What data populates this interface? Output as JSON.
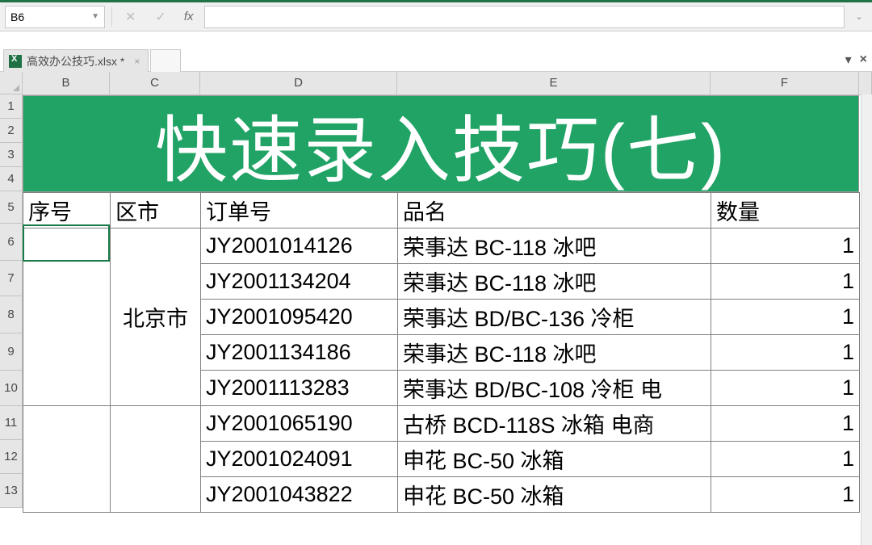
{
  "nameBox": "B6",
  "fxCancel": "✕",
  "fxConfirm": "✓",
  "fxLabel": "fx",
  "fileTab": "高效办公技巧.xlsx *",
  "columns": [
    "B",
    "C",
    "D",
    "E",
    "F"
  ],
  "rowNumbers": [
    1,
    2,
    3,
    4,
    5,
    6,
    7,
    8,
    9,
    10,
    11,
    12,
    13
  ],
  "bannerTitle": "快速录入技巧(七)",
  "headers": {
    "b": "序号",
    "c": "区市",
    "d": "订单号",
    "e": "品名",
    "f": "数量"
  },
  "mergedCity": "北京市",
  "chart_data": {
    "type": "table",
    "title": "快速录入技巧(七)",
    "columns": [
      "序号",
      "区市",
      "订单号",
      "品名",
      "数量"
    ],
    "rows": [
      {
        "序号": "",
        "区市": "北京市",
        "订单号": "JY2001014126",
        "品名": "荣事达 BC-118 冰吧",
        "数量": 1
      },
      {
        "序号": "",
        "区市": "北京市",
        "订单号": "JY2001134204",
        "品名": "荣事达 BC-118 冰吧",
        "数量": 1
      },
      {
        "序号": "",
        "区市": "北京市",
        "订单号": "JY2001095420",
        "品名": "荣事达 BD/BC-136 冷柜",
        "数量": 1
      },
      {
        "序号": "",
        "区市": "北京市",
        "订单号": "JY2001134186",
        "品名": "荣事达 BC-118 冰吧",
        "数量": 1
      },
      {
        "序号": "",
        "区市": "北京市",
        "订单号": "JY2001113283",
        "品名": "荣事达 BD/BC-108 冷柜 电",
        "数量": 1
      },
      {
        "序号": "",
        "区市": "",
        "订单号": "JY2001065190",
        "品名": "古桥 BCD-118S 冰箱 电商",
        "数量": 1
      },
      {
        "序号": "",
        "区市": "",
        "订单号": "JY2001024091",
        "品名": "申花 BC-50 冰箱",
        "数量": 1
      },
      {
        "序号": "",
        "区市": "",
        "订单号": "JY2001043822",
        "品名": "申花 BC-50 冰箱",
        "数量": 1
      }
    ]
  }
}
